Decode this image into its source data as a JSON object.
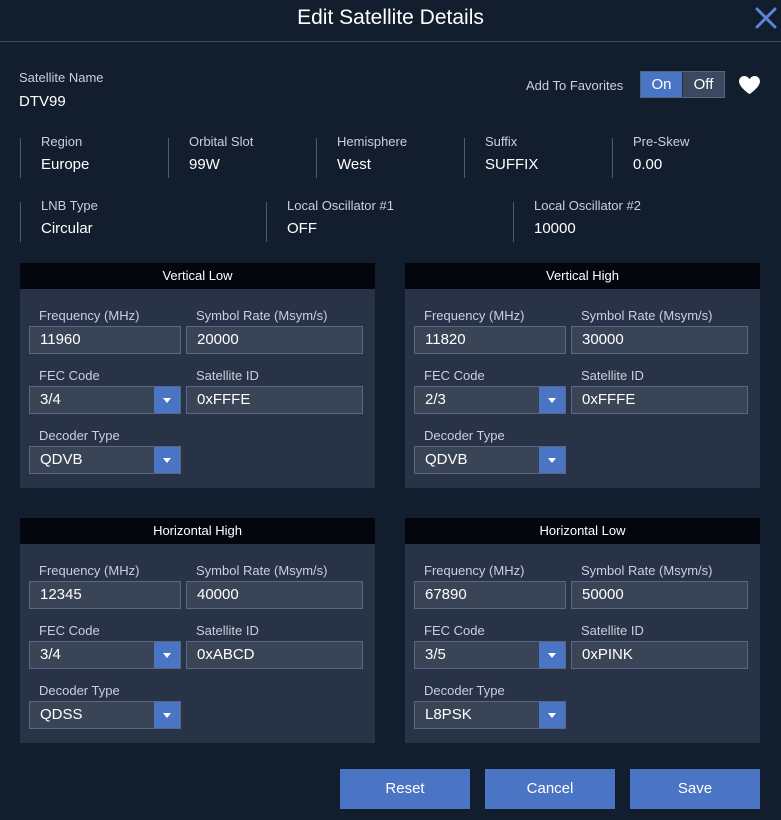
{
  "dialog": {
    "title": "Edit Satellite Details"
  },
  "satellite": {
    "name_label": "Satellite Name",
    "name_value": "DTV99"
  },
  "favorites": {
    "label": "Add To Favorites",
    "on_label": "On",
    "off_label": "Off",
    "selected": "On"
  },
  "info_row1": [
    {
      "label": "Region",
      "value": "Europe"
    },
    {
      "label": "Orbital Slot",
      "value": "99W"
    },
    {
      "label": "Hemisphere",
      "value": "West"
    },
    {
      "label": "Suffix",
      "value": "SUFFIX"
    },
    {
      "label": "Pre-Skew",
      "value": "0.00"
    }
  ],
  "info_row2": [
    {
      "label": "LNB Type",
      "value": "Circular"
    },
    {
      "label": "Local Oscillator #1",
      "value": "OFF"
    },
    {
      "label": "Local Oscillator #2",
      "value": "10000"
    }
  ],
  "field_labels": {
    "frequency": "Frequency (MHz)",
    "symbol_rate": "Symbol Rate (Msym/s)",
    "fec_code": "FEC Code",
    "satellite_id": "Satellite ID",
    "decoder_type": "Decoder Type"
  },
  "panels": [
    {
      "title": "Vertical Low",
      "frequency": "11960",
      "symbol_rate": "20000",
      "fec_code": "3/4",
      "satellite_id": "0xFFFE",
      "decoder_type": "QDVB"
    },
    {
      "title": "Vertical High",
      "frequency": "11820",
      "symbol_rate": "30000",
      "fec_code": "2/3",
      "satellite_id": "0xFFFE",
      "decoder_type": "QDVB"
    },
    {
      "title": "Horizontal High",
      "frequency": "12345",
      "symbol_rate": "40000",
      "fec_code": "3/4",
      "satellite_id": "0xABCD",
      "decoder_type": "QDSS"
    },
    {
      "title": "Horizontal Low",
      "frequency": "67890",
      "symbol_rate": "50000",
      "fec_code": "3/5",
      "satellite_id": "0xPINK",
      "decoder_type": "L8PSK"
    }
  ],
  "buttons": {
    "reset": "Reset",
    "cancel": "Cancel",
    "save": "Save"
  },
  "colors": {
    "accent": "#4a74c4",
    "background": "#121d2e",
    "panel": "#283347",
    "panel_header": "#03060c"
  }
}
